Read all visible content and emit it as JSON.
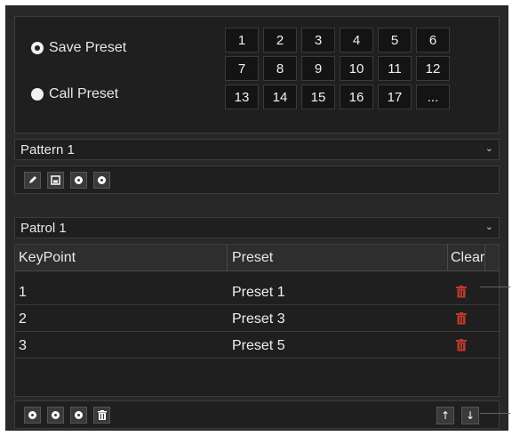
{
  "preset": {
    "save_label": "Save Preset",
    "call_label": "Call Preset",
    "selected": "save",
    "numbers": [
      "1",
      "2",
      "3",
      "4",
      "5",
      "6",
      "7",
      "8",
      "9",
      "10",
      "11",
      "12",
      "13",
      "14",
      "15",
      "16",
      "17",
      "..."
    ]
  },
  "pattern": {
    "selected": "Pattern 1"
  },
  "patrol": {
    "selected": "Patrol 1"
  },
  "table": {
    "headers": {
      "keypoint": "KeyPoint",
      "preset": "Preset",
      "clear": "Clear"
    },
    "rows": [
      {
        "keypoint": "1",
        "preset": "Preset 1"
      },
      {
        "keypoint": "2",
        "preset": "Preset 3"
      },
      {
        "keypoint": "3",
        "preset": "Preset 5"
      }
    ]
  },
  "colors": {
    "panel": "#282828",
    "trash": "#c0392b",
    "text": "#f2f2f2"
  },
  "icons": {
    "pattern_tools": [
      "pencil-icon",
      "save-icon",
      "start-icon",
      "stop-icon"
    ],
    "patrol_tools": [
      "settings-icon",
      "start-icon",
      "stop-icon",
      "delete-icon"
    ],
    "row_action": "trash-icon",
    "order": [
      "up-arrow-icon",
      "down-arrow-icon"
    ]
  }
}
